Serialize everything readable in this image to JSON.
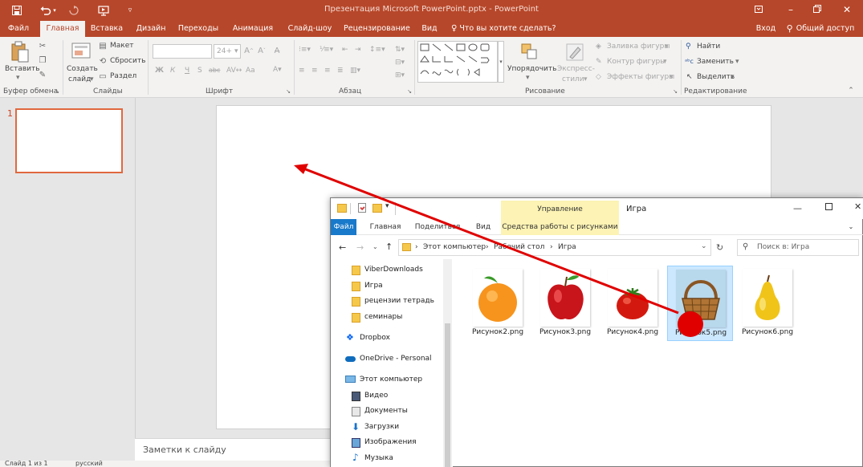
{
  "titlebar": {
    "title": "Презентация Microsoft PowerPoint.pptx - PowerPoint",
    "save_icon": "save-icon",
    "undo_icon": "undo-icon",
    "redo_icon": "redo-icon",
    "present_icon": "present-icon",
    "customize_icon": "customize-icon"
  },
  "tabs": [
    "Файл",
    "Главная",
    "Вставка",
    "Дизайн",
    "Переходы",
    "Анимация",
    "Слайд-шоу",
    "Рецензирование",
    "Вид"
  ],
  "tell_me": "Что вы хотите сделать?",
  "account": {
    "signin": "Вход",
    "share": "Общий доступ"
  },
  "ribbon": {
    "clipboard": {
      "paste": "Вставить",
      "label": "Буфер обмена"
    },
    "slides": {
      "new_slide_1": "Создать",
      "new_slide_2": "слайд",
      "layout": "Макет",
      "reset": "Сбросить",
      "section": "Раздел",
      "label": "Слайды"
    },
    "font": {
      "size": "24+",
      "bold": "Ж",
      "italic": "К",
      "underline": "Ч",
      "strike": "S",
      "spacing": "abc",
      "case": "Аа",
      "label": "Шрифт"
    },
    "paragraph": {
      "label": "Абзац"
    },
    "drawing": {
      "arrange": "Упорядочить",
      "quick_styles_1": "Экспресс-",
      "quick_styles_2": "стили",
      "fill": "Заливка фигуры",
      "outline": "Контур фигуры",
      "effects": "Эффекты фигуры",
      "label": "Рисование"
    },
    "editing": {
      "find": "Найти",
      "replace": "Заменить",
      "select": "Выделить",
      "label": "Редактирование"
    }
  },
  "slides_panel": {
    "slide_number": "1"
  },
  "notes_placeholder": "Заметки к слайду",
  "status": {
    "slide_info": "Слайд 1 из 1",
    "language": "русский"
  },
  "explorer": {
    "window_title": "Игра",
    "manage_tab": "Управление",
    "tabs": [
      "Файл",
      "Главная",
      "Поделиться",
      "Вид",
      "Средства работы с рисунками"
    ],
    "breadcrumb": [
      "Этот компьютер",
      "Рабочий стол",
      "Игра"
    ],
    "search_placeholder": "Поиск в: Игра",
    "nav_items": [
      {
        "label": "ViberDownloads",
        "icon": "folder-icon"
      },
      {
        "label": "Игра",
        "icon": "folder-icon"
      },
      {
        "label": "рецензии тетрадь",
        "icon": "folder-icon"
      },
      {
        "label": "семинары",
        "icon": "folder-icon"
      },
      {
        "label": "Dropbox",
        "icon": "dropbox-icon"
      },
      {
        "label": "OneDrive - Personal",
        "icon": "onedrive-icon"
      },
      {
        "label": "Этот компьютер",
        "icon": "computer-icon"
      },
      {
        "label": "Видео",
        "icon": "video-icon"
      },
      {
        "label": "Документы",
        "icon": "documents-icon"
      },
      {
        "label": "Загрузки",
        "icon": "downloads-icon"
      },
      {
        "label": "Изображения",
        "icon": "pictures-icon"
      },
      {
        "label": "Музыка",
        "icon": "music-icon"
      }
    ],
    "files": [
      {
        "name": "Рисунок2.png",
        "picture": "orange",
        "selected": false
      },
      {
        "name": "Рисунок3.png",
        "picture": "apple",
        "selected": false
      },
      {
        "name": "Рисунок4.png",
        "picture": "tomato",
        "selected": false
      },
      {
        "name": "Рисунок5.png",
        "picture": "basket",
        "selected": true
      },
      {
        "name": "Рисунок6.png",
        "picture": "pear",
        "selected": false
      }
    ]
  },
  "annotation": {
    "color": "#e00000"
  },
  "colors": {
    "accent": "#b7472a",
    "selection": "#cce8ff",
    "explorer_accent": "#1979ca"
  }
}
